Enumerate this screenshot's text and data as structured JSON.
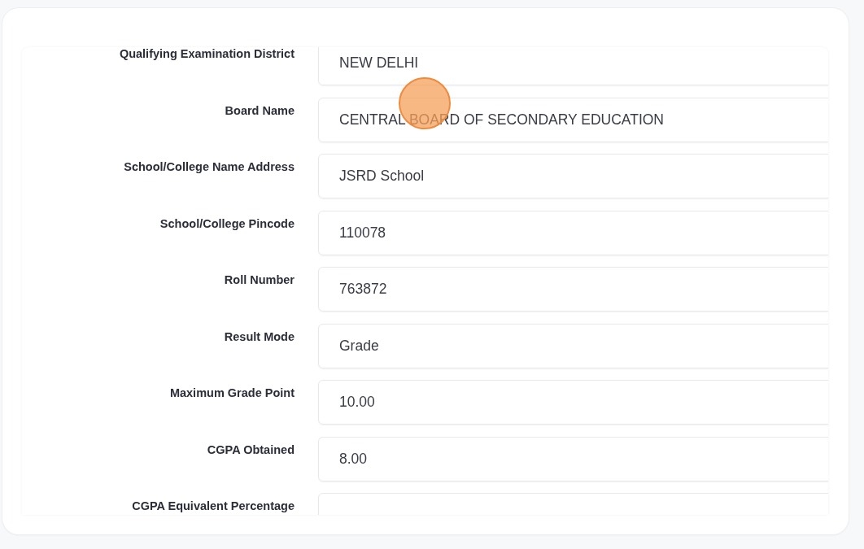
{
  "fields": [
    {
      "label": "Qualifying Examination District",
      "value": "NEW DELHI"
    },
    {
      "label": "Board Name",
      "value": "CENTRAL BOARD OF SECONDARY EDUCATION"
    },
    {
      "label": "School/College Name Address",
      "value": "JSRD School"
    },
    {
      "label": "School/College Pincode",
      "value": "110078"
    },
    {
      "label": "Roll Number",
      "value": "763872"
    },
    {
      "label": "Result Mode",
      "value": "Grade"
    },
    {
      "label": "Maximum Grade Point",
      "value": "10.00"
    },
    {
      "label": "CGPA Obtained",
      "value": "8.00"
    },
    {
      "label": "CGPA Equivalent Percentage"
    }
  ]
}
